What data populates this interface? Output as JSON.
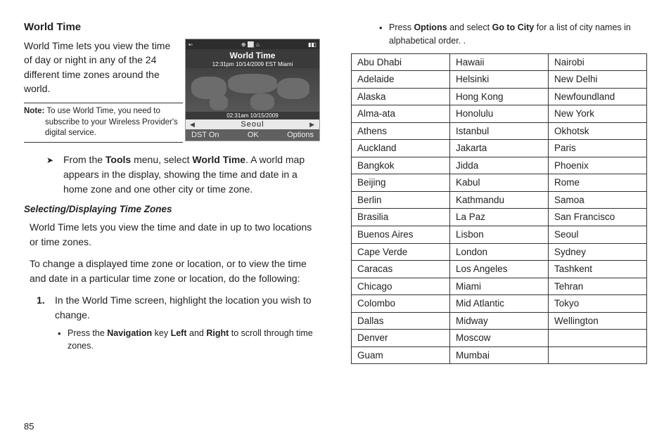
{
  "pageNumber": "85",
  "title": "World Time",
  "intro": "World Time lets you view the time of day or night in any of the 24 different time zones around the world.",
  "note": {
    "label": "Note:",
    "text": "To use World Time, you need to subscribe to your Wireless Provider's digital service."
  },
  "phone": {
    "title": "World Time",
    "topline": "12:31pm 10/14/2009 EST   Miami",
    "botline": "02:31am 10/15/2009",
    "city": "Seoul",
    "sk_left": "DST On",
    "sk_mid": "OK",
    "sk_right": "Options"
  },
  "arrow": {
    "pre": "From the ",
    "tools": "Tools",
    "mid": " menu, select ",
    "wt": "World Time",
    "post": ". A world map appears in the display, showing the time and date in a home zone and one other city or time zone."
  },
  "subsection": "Selecting/Displaying Time Zones",
  "body1": "World Time lets you view the time and date in up to two locations or time zones.",
  "body2": "To change a displayed time zone or location, or to view the time and date in a particular time zone or location, do the following:",
  "step1": {
    "num": "1.",
    "text": "In the World Time screen, highlight the location you wish to change."
  },
  "bullet1": {
    "pre": "Press the ",
    "b1": "Navigation",
    "mid1": " key ",
    "b2": "Left",
    "mid2": " and ",
    "b3": "Right",
    "post": " to scroll through time zones."
  },
  "bullet2": {
    "pre": "Press ",
    "b1": "Options",
    "mid": " and select ",
    "b2": "Go to City",
    "post": " for a list of city names in alphabetical order. ."
  },
  "cities": [
    [
      "Abu Dhabi",
      "Hawaii",
      "Nairobi"
    ],
    [
      "Adelaide",
      "Helsinki",
      "New Delhi"
    ],
    [
      "Alaska",
      "Hong Kong",
      "Newfoundland"
    ],
    [
      "Alma-ata",
      "Honolulu",
      "New York"
    ],
    [
      "Athens",
      "Istanbul",
      "Okhotsk"
    ],
    [
      "Auckland",
      "Jakarta",
      "Paris"
    ],
    [
      "Bangkok",
      "Jidda",
      "Phoenix"
    ],
    [
      "Beijing",
      "Kabul",
      "Rome"
    ],
    [
      "Berlin",
      "Kathmandu",
      "Samoa"
    ],
    [
      "Brasilia",
      "La Paz",
      "San Francisco"
    ],
    [
      "Buenos Aires",
      "Lisbon",
      "Seoul"
    ],
    [
      "Cape Verde",
      "London",
      "Sydney"
    ],
    [
      "Caracas",
      "Los Angeles",
      "Tashkent"
    ],
    [
      "Chicago",
      "Miami",
      "Tehran"
    ],
    [
      "Colombo",
      "Mid Atlantic",
      "Tokyo"
    ],
    [
      "Dallas",
      "Midway",
      "Wellington"
    ],
    [
      "Denver",
      "Moscow",
      ""
    ],
    [
      "Guam",
      "Mumbai",
      ""
    ]
  ]
}
